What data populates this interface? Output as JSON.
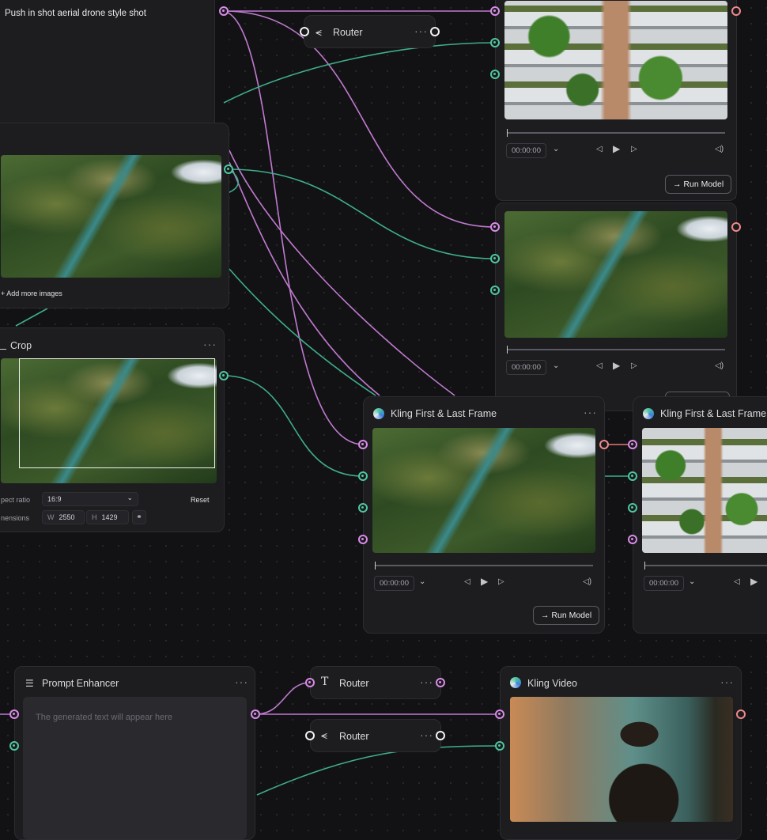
{
  "prompt_node": {
    "text": "Push in shot aerial drone style shot"
  },
  "image_node": {
    "add_more": "+ Add more images"
  },
  "crop_node": {
    "title": "Crop",
    "menu": "···",
    "aspect_label": "pect ratio",
    "aspect_value": "16:9",
    "reset": "Reset",
    "dimensions_label": "nensions",
    "w_label": "W",
    "w_value": "2550",
    "h_label": "H",
    "h_value": "1429"
  },
  "router_top": {
    "title": "Router",
    "menu": "···",
    "icon": "router-split-icon"
  },
  "video_top": {
    "time": "00:00:00",
    "run": "→ Run Model"
  },
  "video_mid": {
    "time": "00:00:00"
  },
  "kling_a": {
    "title": "Kling First & Last Frame",
    "menu": "···",
    "time": "00:00:00",
    "run": "→ Run Model"
  },
  "kling_b": {
    "title": "Kling First & Last Frame",
    "time": "00:00:00"
  },
  "prompt_enhancer": {
    "title": "Prompt Enhancer",
    "menu": "···",
    "placeholder": "The generated text will appear here"
  },
  "router_text": {
    "title": "Router",
    "menu": "···",
    "icon": "text-t-icon"
  },
  "router_split": {
    "title": "Router",
    "menu": "···",
    "icon": "router-split-icon"
  },
  "kling_video": {
    "title": "Kling Video",
    "menu": "···"
  },
  "colors": {
    "pink": "#d98be8",
    "green": "#4fc7a0",
    "coral": "#f08a8a",
    "bg": "#121214",
    "node": "#1d1d20"
  }
}
